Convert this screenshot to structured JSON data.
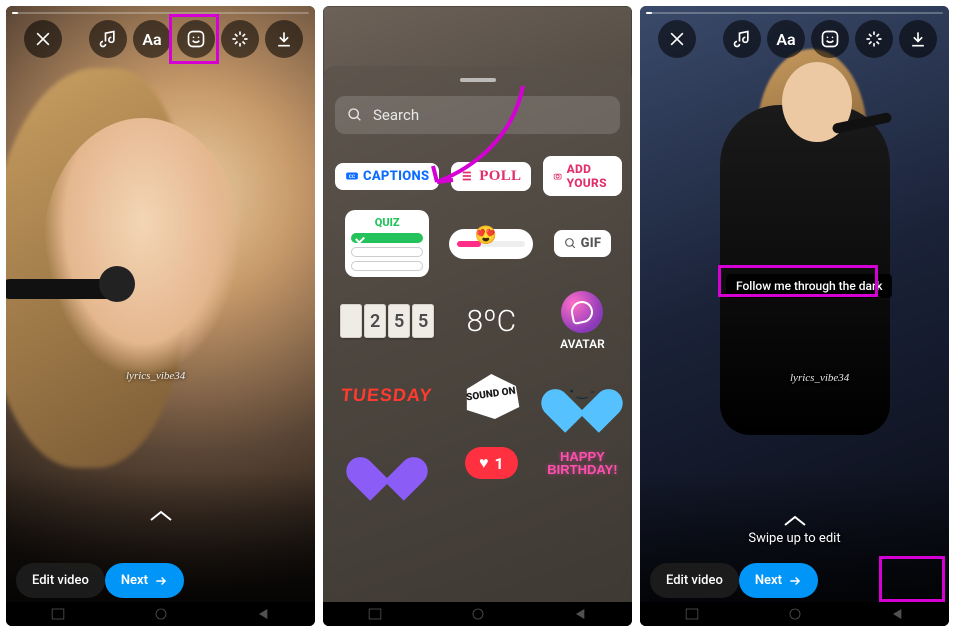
{
  "toolbar": {
    "close": "✕",
    "music": "♪",
    "text": "Aa",
    "sticker": "☺",
    "effects": "✦",
    "download": "⬇"
  },
  "panel1": {
    "edit_video": "Edit video",
    "next": "Next",
    "watermark": "lyrics_vibe34"
  },
  "sheet": {
    "search_placeholder": "Search",
    "captions": "CAPTIONS",
    "poll": "POLL",
    "addyours": "ADD YOURS",
    "quiz": "QUIZ",
    "gif": "GIF",
    "clock_digits": [
      " ",
      "2",
      "5",
      "5"
    ],
    "temperature": "8ºC",
    "avatar": "AVATAR",
    "day": "TUESDAY",
    "soundon": "SOUND ON",
    "like_count": "1",
    "happy_birthday_l1": "HAPPY",
    "happy_birthday_l2": "BIRTHDAY!"
  },
  "panel3": {
    "caption_text": "Follow me through the dark",
    "swipe_hint": "Swipe up to edit",
    "edit_video": "Edit video",
    "next": "Next",
    "watermark": "lyrics_vibe34"
  }
}
